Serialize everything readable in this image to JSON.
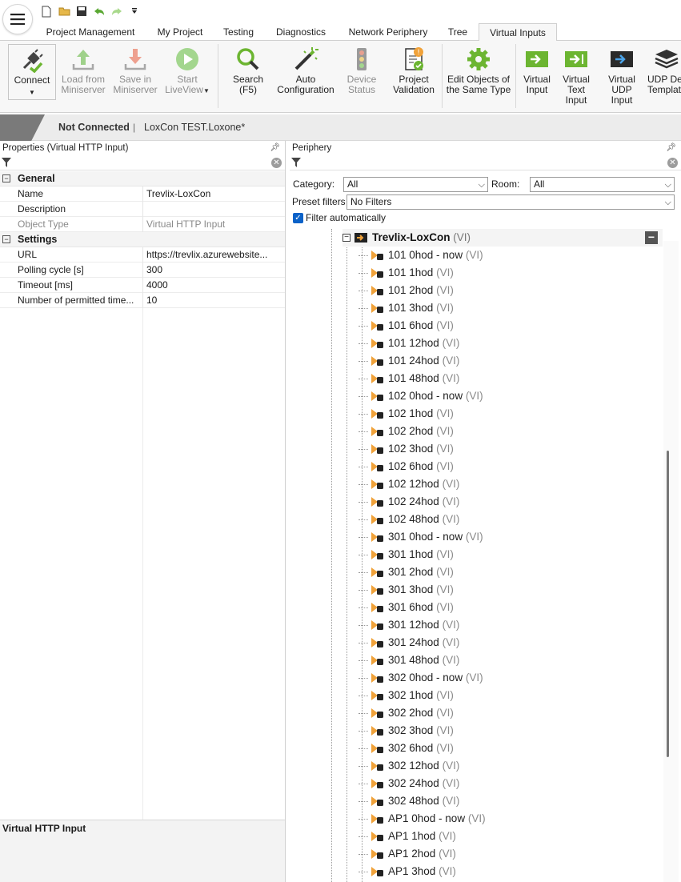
{
  "quick_access": [
    "new-file-icon",
    "open-folder-icon",
    "save-icon",
    "undo-icon",
    "redo-icon",
    "customize-icon"
  ],
  "tabs": [
    "Project Management",
    "My Project",
    "Testing",
    "Diagnostics",
    "Network Periphery",
    "Tree",
    "Virtual Inputs"
  ],
  "active_tab": "Virtual Inputs",
  "ribbon": {
    "connect": "Connect",
    "load1": "Load from",
    "load2": "Miniserver",
    "save1": "Save in",
    "save2": "Miniserver",
    "start1": "Start",
    "start2": "LiveView",
    "search1": "Search",
    "search2": "(F5)",
    "auto1": "Auto",
    "auto2": "Configuration",
    "dev1": "Device",
    "dev2": "Status",
    "valid1": "Project",
    "valid2": "Validation",
    "edit1": "Edit Objects of",
    "edit2": "the Same Type",
    "vi1": "Virtual",
    "vi2": "Input",
    "vti1": "Virtual",
    "vti2": "Text Input",
    "vudp1": "Virtual",
    "vudp2": "UDP Input",
    "udpt1": "UDP Devi",
    "udpt2": "Template"
  },
  "status": {
    "connection": "Not Connected",
    "separator": "|",
    "project": "LoxCon TEST.Loxone*"
  },
  "properties": {
    "title": "Properties (Virtual HTTP Input)",
    "general": "General",
    "settings": "Settings",
    "rows": [
      {
        "k": "Name",
        "v": "Trevlix-LoxCon"
      },
      {
        "k": "Description",
        "v": ""
      },
      {
        "k": "Object Type",
        "v": "Virtual HTTP Input"
      }
    ],
    "settings_rows": [
      {
        "k": "URL",
        "v": "https://trevlix.azurewebsite..."
      },
      {
        "k": "Polling cycle [s]",
        "v": "300"
      },
      {
        "k": "Timeout [ms]",
        "v": "4000"
      },
      {
        "k": "Number of permitted time...",
        "v": "10"
      }
    ],
    "description_title": "Virtual HTTP Input"
  },
  "periphery": {
    "title": "Periphery",
    "category_label": "Category:",
    "category_value": "All",
    "room_label": "Room:",
    "room_value": "All",
    "preset_label": "Preset filters",
    "preset_value": "No Filters",
    "filter_auto": "Filter automatically",
    "root_name": "Trevlix-LoxCon",
    "root_tag": "(VI)",
    "items": [
      "101 0hod - now",
      "101 1hod",
      "101 2hod",
      "101 3hod",
      "101 6hod",
      "101 12hod",
      "101 24hod",
      "101 48hod",
      "102 0hod - now",
      "102 1hod",
      "102 2hod",
      "102 3hod",
      "102 6hod",
      "102 12hod",
      "102 24hod",
      "102 48hod",
      "301 0hod - now",
      "301 1hod",
      "301 2hod",
      "301 3hod",
      "301 6hod",
      "301 12hod",
      "301 24hod",
      "301 48hod",
      "302 0hod - now",
      "302 1hod",
      "302 2hod",
      "302 3hod",
      "302 6hod",
      "302 12hod",
      "302 24hod",
      "302 48hod",
      "AP1 0hod - now",
      "AP1 1hod",
      "AP1 2hod",
      "AP1 3hod"
    ],
    "item_tag": "(VI)"
  }
}
